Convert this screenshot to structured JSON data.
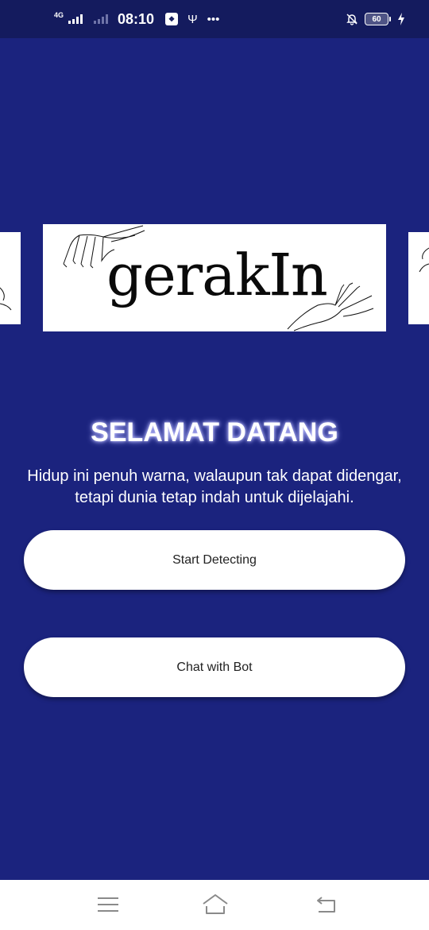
{
  "status_bar": {
    "network": "4G",
    "time": "08:10",
    "battery": "60",
    "icons": [
      "signal-icon",
      "signal-secondary-icon",
      "app-notification-icon",
      "usb-icon",
      "more-notifications-icon",
      "mute-bell-icon",
      "battery-icon",
      "charging-icon"
    ]
  },
  "carousel": {
    "logo_text_main": "gerak",
    "logo_text_light": "In"
  },
  "welcome": {
    "title": "SELAMAT DATANG",
    "subtitle_line1": "Hidup ini penuh warna, walaupun tak dapat didengar,",
    "subtitle_line2": "tetapi dunia tetap indah untuk dijelajahi."
  },
  "buttons": {
    "start_detecting": "Start Detecting",
    "chat_with_bot": "Chat with Bot"
  },
  "nav_bar": {
    "icons": [
      "menu-icon",
      "home-icon",
      "back-icon"
    ]
  },
  "colors": {
    "background": "#1b237e",
    "status_bar": "#141b5e",
    "button": "#ffffff",
    "nav_bar": "#ffffff"
  }
}
